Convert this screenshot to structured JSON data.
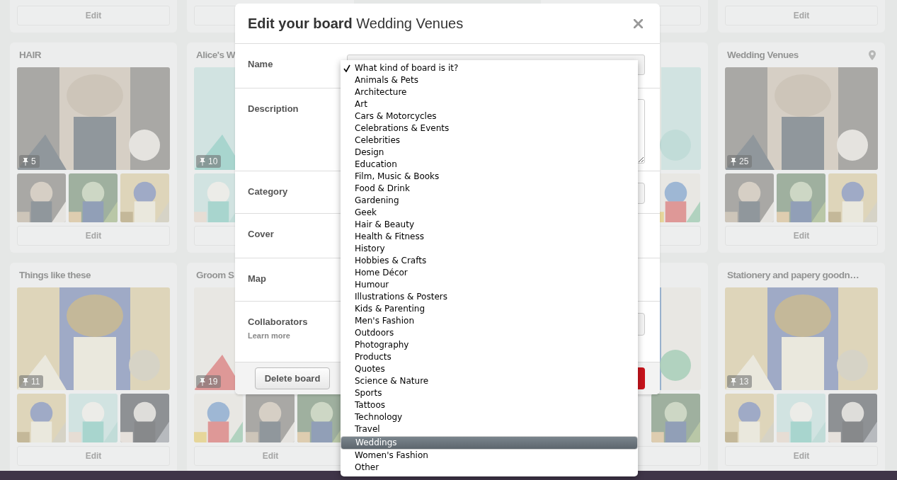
{
  "boards": {
    "columns": [
      {
        "cards": [
          {
            "kind": "stub",
            "edit": "Edit"
          },
          {
            "kind": "board",
            "title": "HAIR",
            "pins": "5",
            "edit": "Edit",
            "location": false,
            "thumbs": [
              {
                "kind": "picture"
              },
              {
                "kind": "picture"
              },
              {
                "kind": "picture"
              }
            ]
          },
          {
            "kind": "board",
            "title": "Things like these",
            "pins": "11",
            "edit": "Edit",
            "location": false,
            "thumbs": [
              {
                "kind": "picture"
              },
              {
                "kind": "picture"
              },
              {
                "kind": "picture"
              }
            ]
          }
        ]
      },
      {
        "cards": [
          {
            "kind": "stub"
          },
          {
            "kind": "board",
            "title": "Alice's W",
            "pins": "10",
            "thumbs": [
              {
                "kind": "picture"
              },
              {
                "kind": "covered"
              },
              {
                "kind": "covered"
              }
            ]
          },
          {
            "kind": "board",
            "title": "Groom S",
            "pins": "19",
            "edit": "Edit",
            "thumbs": [
              {
                "kind": "picture"
              },
              {
                "kind": "picture"
              },
              {
                "kind": "picture"
              }
            ]
          }
        ]
      },
      {
        "cards": [
          {
            "kind": "covered-stub"
          },
          {
            "kind": "covered-board"
          },
          {
            "kind": "covered-board"
          }
        ]
      },
      {
        "cards": [
          {
            "kind": "stub"
          },
          {
            "kind": "board",
            "thumbs": [
              {
                "kind": "covered"
              },
              {
                "kind": "covered"
              },
              {
                "kind": "picture"
              }
            ]
          },
          {
            "kind": "board",
            "thumbs": [
              {
                "kind": "covered"
              },
              {
                "kind": "covered"
              },
              {
                "kind": "picture"
              }
            ]
          }
        ]
      },
      {
        "cards": [
          {
            "kind": "stub",
            "edit": "Edit"
          },
          {
            "kind": "board",
            "title": "Wedding Venues",
            "pins": "25",
            "edit": "Edit",
            "location": true,
            "thumbs": [
              {
                "kind": "picture"
              },
              {
                "kind": "picture"
              },
              {
                "kind": "picture"
              }
            ]
          },
          {
            "kind": "board",
            "title": "Stationery and papery goodn…",
            "pins": "13",
            "edit": "Edit",
            "location": false,
            "thumbs": [
              {
                "kind": "picture"
              },
              {
                "kind": "picture"
              },
              {
                "kind": "picture"
              }
            ]
          }
        ]
      }
    ]
  },
  "modal": {
    "title_bold": "Edit your board",
    "title_name": "Wedding Venues",
    "fields": [
      {
        "label": "Name",
        "kind": "input"
      },
      {
        "label": "Description",
        "kind": "textarea"
      },
      {
        "label": "Category",
        "kind": "select"
      },
      {
        "label": "Cover",
        "kind": "blank"
      },
      {
        "label": "Map",
        "kind": "blank"
      },
      {
        "label": "Collaborators",
        "link": "Learn more",
        "kind": "invite"
      }
    ],
    "delete_button": "Delete board"
  },
  "category_menu": {
    "items": [
      {
        "label": "What kind of board is it?",
        "checked": true,
        "selected": false
      },
      {
        "label": "Animals & Pets",
        "checked": false,
        "selected": false
      },
      {
        "label": "Architecture",
        "checked": false,
        "selected": false
      },
      {
        "label": "Art",
        "checked": false,
        "selected": false
      },
      {
        "label": "Cars & Motorcycles",
        "checked": false,
        "selected": false
      },
      {
        "label": "Celebrations & Events",
        "checked": false,
        "selected": false
      },
      {
        "label": "Celebrities",
        "checked": false,
        "selected": false
      },
      {
        "label": "Design",
        "checked": false,
        "selected": false
      },
      {
        "label": "Education",
        "checked": false,
        "selected": false
      },
      {
        "label": "Film, Music & Books",
        "checked": false,
        "selected": false
      },
      {
        "label": "Food & Drink",
        "checked": false,
        "selected": false
      },
      {
        "label": "Gardening",
        "checked": false,
        "selected": false
      },
      {
        "label": "Geek",
        "checked": false,
        "selected": false
      },
      {
        "label": "Hair & Beauty",
        "checked": false,
        "selected": false
      },
      {
        "label": "Health & Fitness",
        "checked": false,
        "selected": false
      },
      {
        "label": "History",
        "checked": false,
        "selected": false
      },
      {
        "label": "Hobbies & Crafts",
        "checked": false,
        "selected": false
      },
      {
        "label": "Home Décor",
        "checked": false,
        "selected": false
      },
      {
        "label": "Humour",
        "checked": false,
        "selected": false
      },
      {
        "label": "Illustrations & Posters",
        "checked": false,
        "selected": false
      },
      {
        "label": "Kids & Parenting",
        "checked": false,
        "selected": false
      },
      {
        "label": "Men's Fashion",
        "checked": false,
        "selected": false
      },
      {
        "label": "Outdoors",
        "checked": false,
        "selected": false
      },
      {
        "label": "Photography",
        "checked": false,
        "selected": false
      },
      {
        "label": "Products",
        "checked": false,
        "selected": false
      },
      {
        "label": "Quotes",
        "checked": false,
        "selected": false
      },
      {
        "label": "Science & Nature",
        "checked": false,
        "selected": false
      },
      {
        "label": "Sports",
        "checked": false,
        "selected": false
      },
      {
        "label": "Tattoos",
        "checked": false,
        "selected": false
      },
      {
        "label": "Technology",
        "checked": false,
        "selected": false
      },
      {
        "label": "Travel",
        "checked": false,
        "selected": false
      },
      {
        "label": "Weddings",
        "checked": false,
        "selected": true
      },
      {
        "label": "Women's Fashion",
        "checked": false,
        "selected": false
      },
      {
        "label": "Other",
        "checked": false,
        "selected": false
      }
    ]
  }
}
